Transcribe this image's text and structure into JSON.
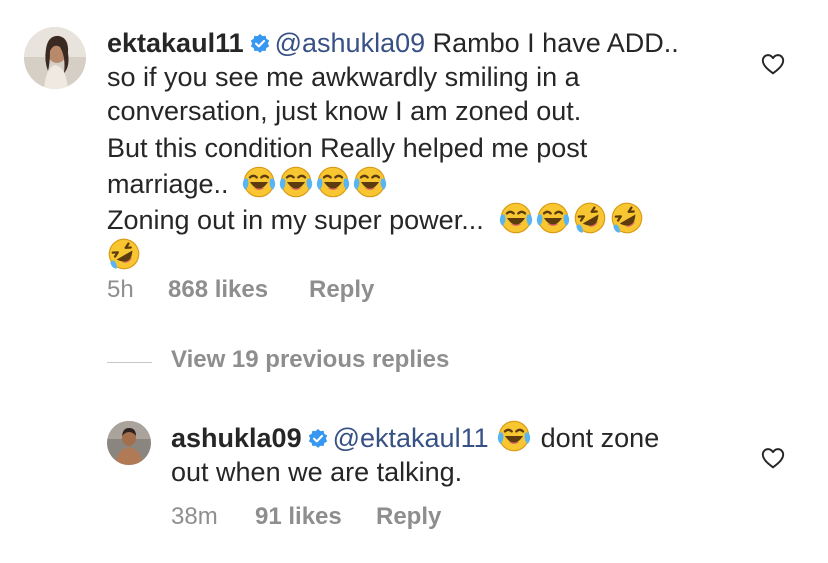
{
  "comment": {
    "username": "ektakaul11",
    "mention": "@ashukla09",
    "text_lines": [
      "Rambo I have ADD..",
      "so if you see me awkwardly smiling in a",
      "conversation, just know I am zoned out.",
      "But this condition Really helped me post",
      "marriage..",
      "Zoning out in my super power..."
    ],
    "time": "5h",
    "likes": "868 likes",
    "reply_label": "Reply"
  },
  "view_replies": "View 19 previous replies",
  "reply": {
    "username": "ashukla09",
    "mention": "@ektakaul11",
    "text_line1": "dont zone",
    "text_line2": "out when we are talking.",
    "time": "38m",
    "likes": "91 likes",
    "reply_label": "Reply"
  },
  "colors": {
    "text": "#262626",
    "mention": "#385185",
    "meta": "#8e8e8e",
    "verified": "#3897f0"
  },
  "icons": [
    "verified-badge-icon",
    "heart-icon",
    "tears-of-joy-emoji",
    "rofl-emoji"
  ]
}
